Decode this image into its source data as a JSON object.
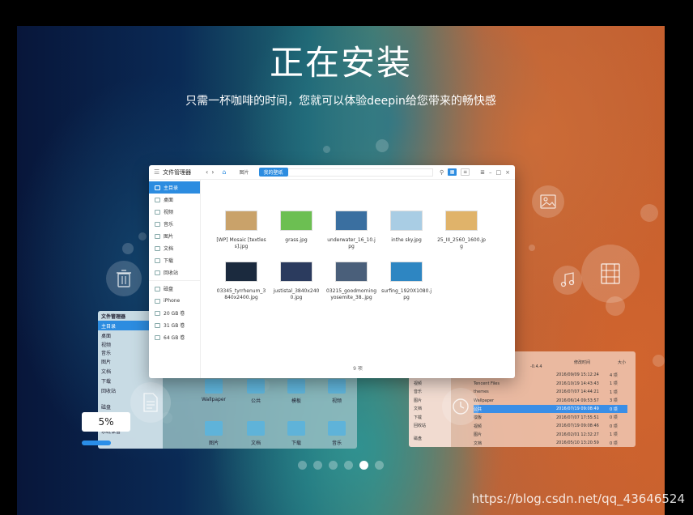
{
  "header": {
    "title": "正在安装",
    "subtitle": "只需一杯咖啡的时间，您就可以体验deepin给您带来的畅快感"
  },
  "file_manager": {
    "app_title": "文件管理器",
    "breadcrumbs": [
      "图片",
      "我的壁纸"
    ],
    "sidebar": [
      {
        "label": "主目录",
        "active": true
      },
      {
        "label": "桌面"
      },
      {
        "label": "视频"
      },
      {
        "label": "音乐"
      },
      {
        "label": "图片"
      },
      {
        "label": "文档"
      },
      {
        "label": "下载"
      },
      {
        "label": "回收站"
      },
      {
        "label": "磁盘"
      },
      {
        "label": "iPhone"
      },
      {
        "label": "20 GB 卷"
      },
      {
        "label": "31 GB 卷"
      },
      {
        "label": "64 GB 卷"
      }
    ],
    "files": [
      {
        "name": "[WP] Mosaic [textless].jpg",
        "color": "#c9a26a"
      },
      {
        "name": "grass.jpg",
        "color": "#6cbf52"
      },
      {
        "name": "underwater_16_10.jpg",
        "color": "#3a6fa0"
      },
      {
        "name": "inthe sky.jpg",
        "color": "#a9cde4"
      },
      {
        "name": "25_III_2560_1600.jpg",
        "color": "#e0b36a"
      },
      {
        "name": "03345_tyrrhenum_3840x2400.jpg",
        "color": "#1b2a3e"
      },
      {
        "name": "justistal_3840x2400.jpg",
        "color": "#2b3b5e"
      },
      {
        "name": "03215_goodmorningyosemite_38..jpg",
        "color": "#4a5f7a"
      },
      {
        "name": "surfing_1920X1080.jpg",
        "color": "#2e86c2"
      }
    ],
    "count_label": "9 项"
  },
  "bg_left_window": {
    "title": "文件管理器",
    "sidebar": [
      "主目录",
      "桌面",
      "视频",
      "音乐",
      "图片",
      "文档",
      "下载",
      "回收站",
      "磁盘",
      "系统保留"
    ],
    "folders": [
      "Wallpaper",
      "公共",
      "模板",
      "视频",
      "图片",
      "文档",
      "下载",
      "音乐"
    ]
  },
  "bg_right_window": {
    "header_version": "-0.4.4",
    "col_modified": "修改时间",
    "col_size": "大小",
    "sidebar": [
      "视频",
      "音乐",
      "图片",
      "文档",
      "下载",
      "回收站",
      "磁盘"
    ],
    "rows": [
      {
        "name": "share",
        "date": "2016/09/09 15:12:24",
        "size": "4 项"
      },
      {
        "name": "Tencent Files",
        "date": "2016/10/19 14:43:43",
        "size": "1 项"
      },
      {
        "name": "themes",
        "date": "2016/07/07 14:44:21",
        "size": "1 项"
      },
      {
        "name": "Wallpaper",
        "date": "2016/06/14 09:53:57",
        "size": "3 项"
      },
      {
        "name": "公共",
        "date": "2016/07/19 09:08:49",
        "size": "0 项",
        "active": true
      },
      {
        "name": "模板",
        "date": "2016/07/07 17:55:51",
        "size": "0 项"
      },
      {
        "name": "视频",
        "date": "2016/07/19 09:08:46",
        "size": "0 项"
      },
      {
        "name": "图片",
        "date": "2016/02/01 12:32:27",
        "size": "1 项"
      },
      {
        "name": "文档",
        "date": "2016/05/10 13:20:59",
        "size": "0 项"
      }
    ]
  },
  "progress": {
    "percent_label": "5%",
    "value": 0.05,
    "color": "#2a8ee8"
  },
  "pager": {
    "count": 6,
    "active_index": 4
  },
  "watermark": "https://blog.csdn.net/qq_43646524"
}
